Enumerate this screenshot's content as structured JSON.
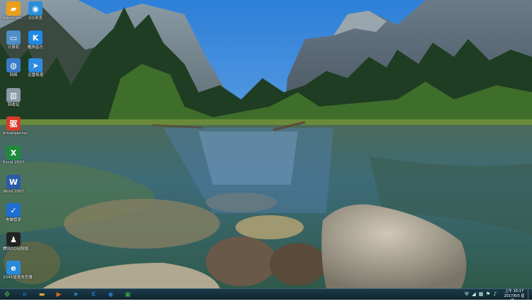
{
  "desktop_icons": [
    {
      "name": "admin-folder",
      "label": "Administr...",
      "icon": "folder-user-icon",
      "color": "#e8a019"
    },
    {
      "name": "qq-browser",
      "label": "QQ浏览",
      "icon": "qq-browser-icon",
      "color": "#2a8fd8"
    },
    {
      "name": "computer",
      "label": "计算机",
      "icon": "computer-icon",
      "color": "#4f8fc9"
    },
    {
      "name": "kugou-music",
      "label": "酷狗音乐",
      "icon": "kugou-icon",
      "color": "#1e88e5"
    },
    {
      "name": "network",
      "label": "网络",
      "icon": "network-globe-icon",
      "color": "#3a7bc8"
    },
    {
      "name": "thunder",
      "label": "迅雷极速",
      "icon": "thunder-bird-icon",
      "color": "#2c8be0"
    },
    {
      "name": "recycle-bin",
      "label": "回收站",
      "icon": "recycle-bin-icon",
      "color": "#8a9aa8"
    },
    {
      "name": "driver-genius",
      "label": "drivergenius",
      "icon": "driver-genius-icon",
      "color": "#d83a2a"
    },
    {
      "name": "excel-2007",
      "label": "Excel 2007",
      "icon": "excel-icon",
      "color": "#1f8a3c"
    },
    {
      "name": "word-2007",
      "label": "Word 2007",
      "icon": "word-icon",
      "color": "#2a5aa8"
    },
    {
      "name": "pc-manager",
      "label": "电脑管家",
      "icon": "shield-icon",
      "color": "#1e6fd0"
    },
    {
      "name": "tencent-qq",
      "label": "腾讯QQ轻聊版",
      "icon": "qq-penguin-icon",
      "color": "#222222"
    },
    {
      "name": "ie-2345",
      "label": "2345加速浏览器",
      "icon": "ie-browser-icon",
      "color": "#2a8ad8"
    }
  ],
  "taskbar": {
    "pinned": [
      {
        "name": "start",
        "icon": "start-orb-icon",
        "glyph": "❖",
        "color": "#3b8f3b"
      },
      {
        "name": "ie",
        "icon": "ie-icon",
        "glyph": "e",
        "color": "#1a7fd0"
      },
      {
        "name": "explorer",
        "icon": "folder-icon",
        "glyph": "▬",
        "color": "#d9a93a"
      },
      {
        "name": "media-player",
        "icon": "media-player-icon",
        "glyph": "▶",
        "color": "#e06a1a"
      },
      {
        "name": "thunder",
        "icon": "thunder-icon",
        "glyph": "➤",
        "color": "#3a90e0"
      },
      {
        "name": "kugou",
        "icon": "kugou-icon",
        "glyph": "K",
        "color": "#1e88e5"
      },
      {
        "name": "browser-2345",
        "icon": "globe-icon",
        "glyph": "◉",
        "color": "#2a7ad0"
      },
      {
        "name": "app-green",
        "icon": "monitor-icon",
        "glyph": "▣",
        "color": "#2aa84a"
      }
    ],
    "clock_time": "上午 10:17",
    "clock_date": "2017/6/5 星期一"
  }
}
